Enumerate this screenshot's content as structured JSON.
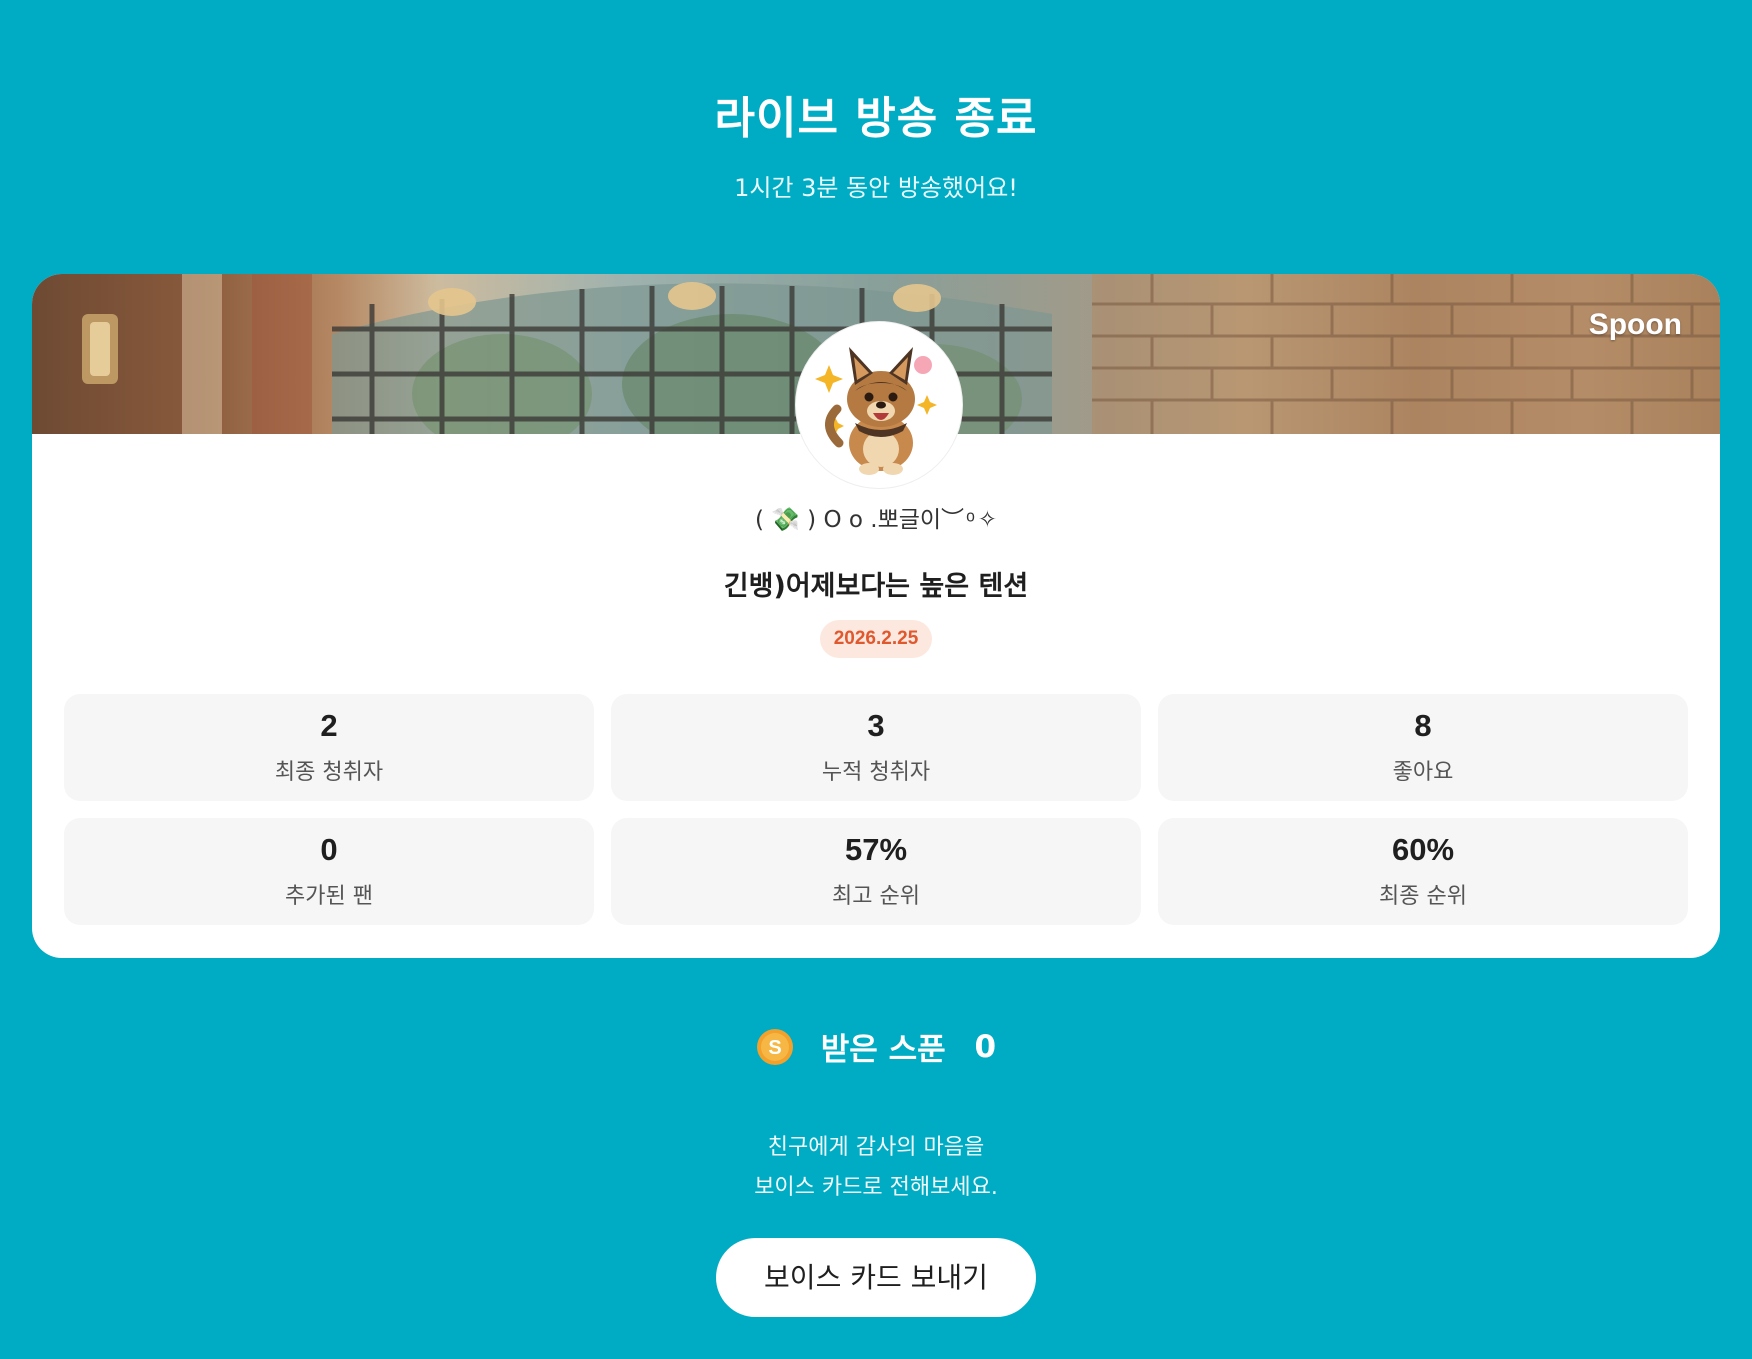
{
  "header": {
    "title": "라이브 방송 종료",
    "subtitle": "1시간 3분 동안 방송했어요!"
  },
  "card": {
    "brand_logo": "Spoon",
    "banner_image": "cafe-interior-brick-wall-photo",
    "avatar_icon": "puppy-avatar",
    "nickname": "( 💸 ) O o .뽀글이︶ ͦ ✧",
    "broadcast_title": "긴뱅)어제보다는 높은 텐션",
    "date": "2026.2.25",
    "stats": [
      {
        "value": "2",
        "label": "최종 청취자"
      },
      {
        "value": "3",
        "label": "누적 청취자"
      },
      {
        "value": "8",
        "label": "좋아요"
      },
      {
        "value": "0",
        "label": "추가된 팬"
      },
      {
        "value": "57%",
        "label": "최고 순위"
      },
      {
        "value": "60%",
        "label": "최종 순위"
      }
    ]
  },
  "spoons": {
    "icon": "spoon-coin-icon",
    "label": "받은 스푼",
    "count": "0"
  },
  "message": {
    "line1": "친구에게 감사의 마음을",
    "line2": "보이스 카드로 전해보세요."
  },
  "action": {
    "button_label": "보이스 카드 보내기"
  },
  "colors": {
    "background": "#00acc4",
    "card": "#ffffff",
    "stat_box": "#f6f6f6",
    "date_badge_bg": "#fde8e0",
    "date_badge_text": "#e0582e",
    "coin": "#f5a623"
  }
}
